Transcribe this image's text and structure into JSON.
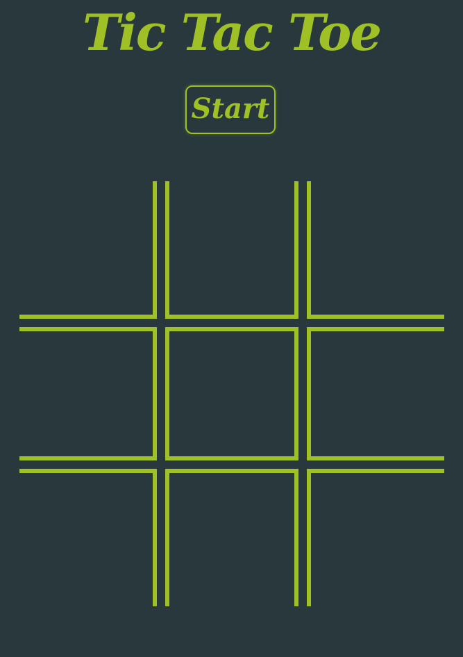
{
  "title": "Tic Tac Toe",
  "start_button": {
    "label": "Start"
  },
  "board": {
    "cells": [
      "",
      "",
      "",
      "",
      "",
      "",
      "",
      "",
      ""
    ]
  },
  "colors": {
    "background": "#28383c",
    "accent": "#9fc125"
  }
}
